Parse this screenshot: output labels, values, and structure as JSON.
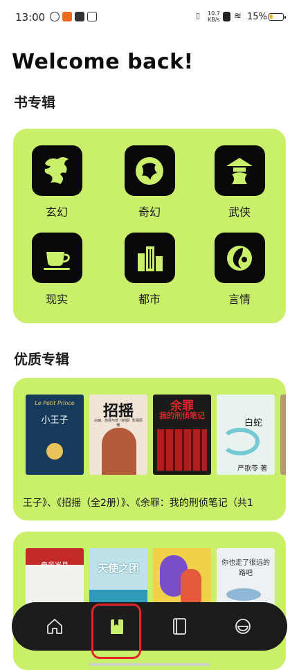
{
  "status": {
    "time": "13:00",
    "net_speed": "10.7\nKB/s",
    "battery": "15%"
  },
  "welcome": "Welcome back!",
  "categories_section": {
    "title": "书专辑",
    "items": [
      {
        "label": "玄幻",
        "icon": "dragon-icon"
      },
      {
        "label": "奇幻",
        "icon": "wyvern-icon"
      },
      {
        "label": "武侠",
        "icon": "swordsman-icon"
      },
      {
        "label": "现实",
        "icon": "teacup-icon"
      },
      {
        "label": "都市",
        "icon": "city-buildings-icon"
      },
      {
        "label": "言情",
        "icon": "cloud-heart-icon"
      }
    ]
  },
  "featured_section": {
    "title": "优质专辑",
    "album1": {
      "text": "王子》、《招摇（全2册）》、《余罪：我的刑侦笔记（共1",
      "books": [
        {
          "title": "小王子",
          "subtitle": "Le Petit Prince"
        },
        {
          "title": "招摇",
          "subtitle": "白幽、自我与他（新版）影视原著"
        },
        {
          "title": "余罪",
          "subtitle": "我的刑侦笔记"
        },
        {
          "title": "白蛇",
          "author": "严歌苓 著"
        }
      ]
    },
    "album2": {
      "books": [
        {
          "title": "奇风岁月"
        },
        {
          "title": "天使之团"
        },
        {
          "title": ""
        },
        {
          "title": "你也走了很远的路吧"
        }
      ]
    }
  },
  "bottom_nav": {
    "items": [
      "home-icon",
      "bookshelf-icon",
      "notebook-icon",
      "profile-icon"
    ],
    "active": "bookshelf-icon"
  },
  "colors": {
    "accent": "#c9ef6b",
    "navbar": "#1c1c1c",
    "highlight": "#e0262a"
  }
}
